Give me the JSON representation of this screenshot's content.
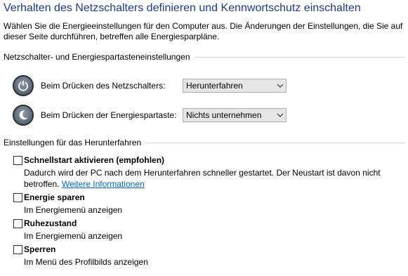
{
  "page": {
    "title": "Verhalten des Netzschalters definieren und Kennwortschutz einschalten",
    "intro": "Wählen Sie die Energieeinstellungen für den Computer aus. Die Änderungen der Einstellungen, die Sie auf dieser Seite durchführen, betreffen alle Energiesparpläne."
  },
  "power_settings": {
    "header": "Netzschalter- und Energiespartasteneinstellungen",
    "power_button": {
      "label": "Beim Drücken des Netzschalters:",
      "value": "Herunterfahren",
      "icon": "power-button-icon"
    },
    "sleep_button": {
      "label": "Beim Drücken der Energiespartaste:",
      "value": "Nichts unternehmen",
      "icon": "sleep-button-icon"
    }
  },
  "shutdown_settings": {
    "header": "Einstellungen für das Herunterfahren",
    "fast_startup": {
      "title": "Schnellstart aktivieren (empfohlen)",
      "desc": "Dadurch wird der PC nach dem Herunterfahren schneller gestartet. Der Neustart ist davon nicht betroffen.",
      "link": "Weitere Informationen",
      "checked": false
    },
    "sleep": {
      "title": "Energie sparen",
      "desc": "Im Energiemenü anzeigen",
      "checked": false
    },
    "hibernate": {
      "title": "Ruhezustand",
      "desc": "Im Energiemenü anzeigen",
      "checked": false
    },
    "lock": {
      "title": "Sperren",
      "desc": "Im Menü des Profilbilds anzeigen",
      "checked": false
    }
  }
}
